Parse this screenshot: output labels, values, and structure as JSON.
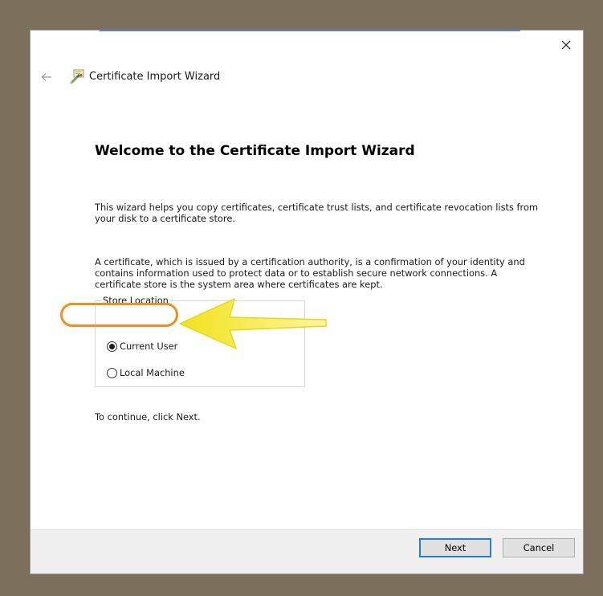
{
  "window": {
    "title": "Certificate Import Wizard",
    "back_icon": "back-arrow-icon",
    "close_icon": "close-icon",
    "title_icon": "certificate-icon"
  },
  "content": {
    "heading": "Welcome to the Certificate Import Wizard",
    "paragraph1": "This wizard helps you copy certificates, certificate trust lists, and certificate revocation lists from your disk to a certificate store.",
    "paragraph2": "A certificate, which is issued by a certification authority, is a confirmation of your identity and contains information used to protect data or to establish secure network connections. A certificate store is the system area where certificates are kept.",
    "store_location": {
      "legend": "Store Location",
      "options": [
        {
          "label": "Current User",
          "selected": true
        },
        {
          "label": "Local Machine",
          "selected": false
        }
      ]
    },
    "continue_text": "To continue, click Next."
  },
  "footer": {
    "next_label": "Next",
    "cancel_label": "Cancel"
  },
  "annotations": {
    "highlight_color": "#f0901e",
    "arrow_color": "#f7e81a"
  }
}
